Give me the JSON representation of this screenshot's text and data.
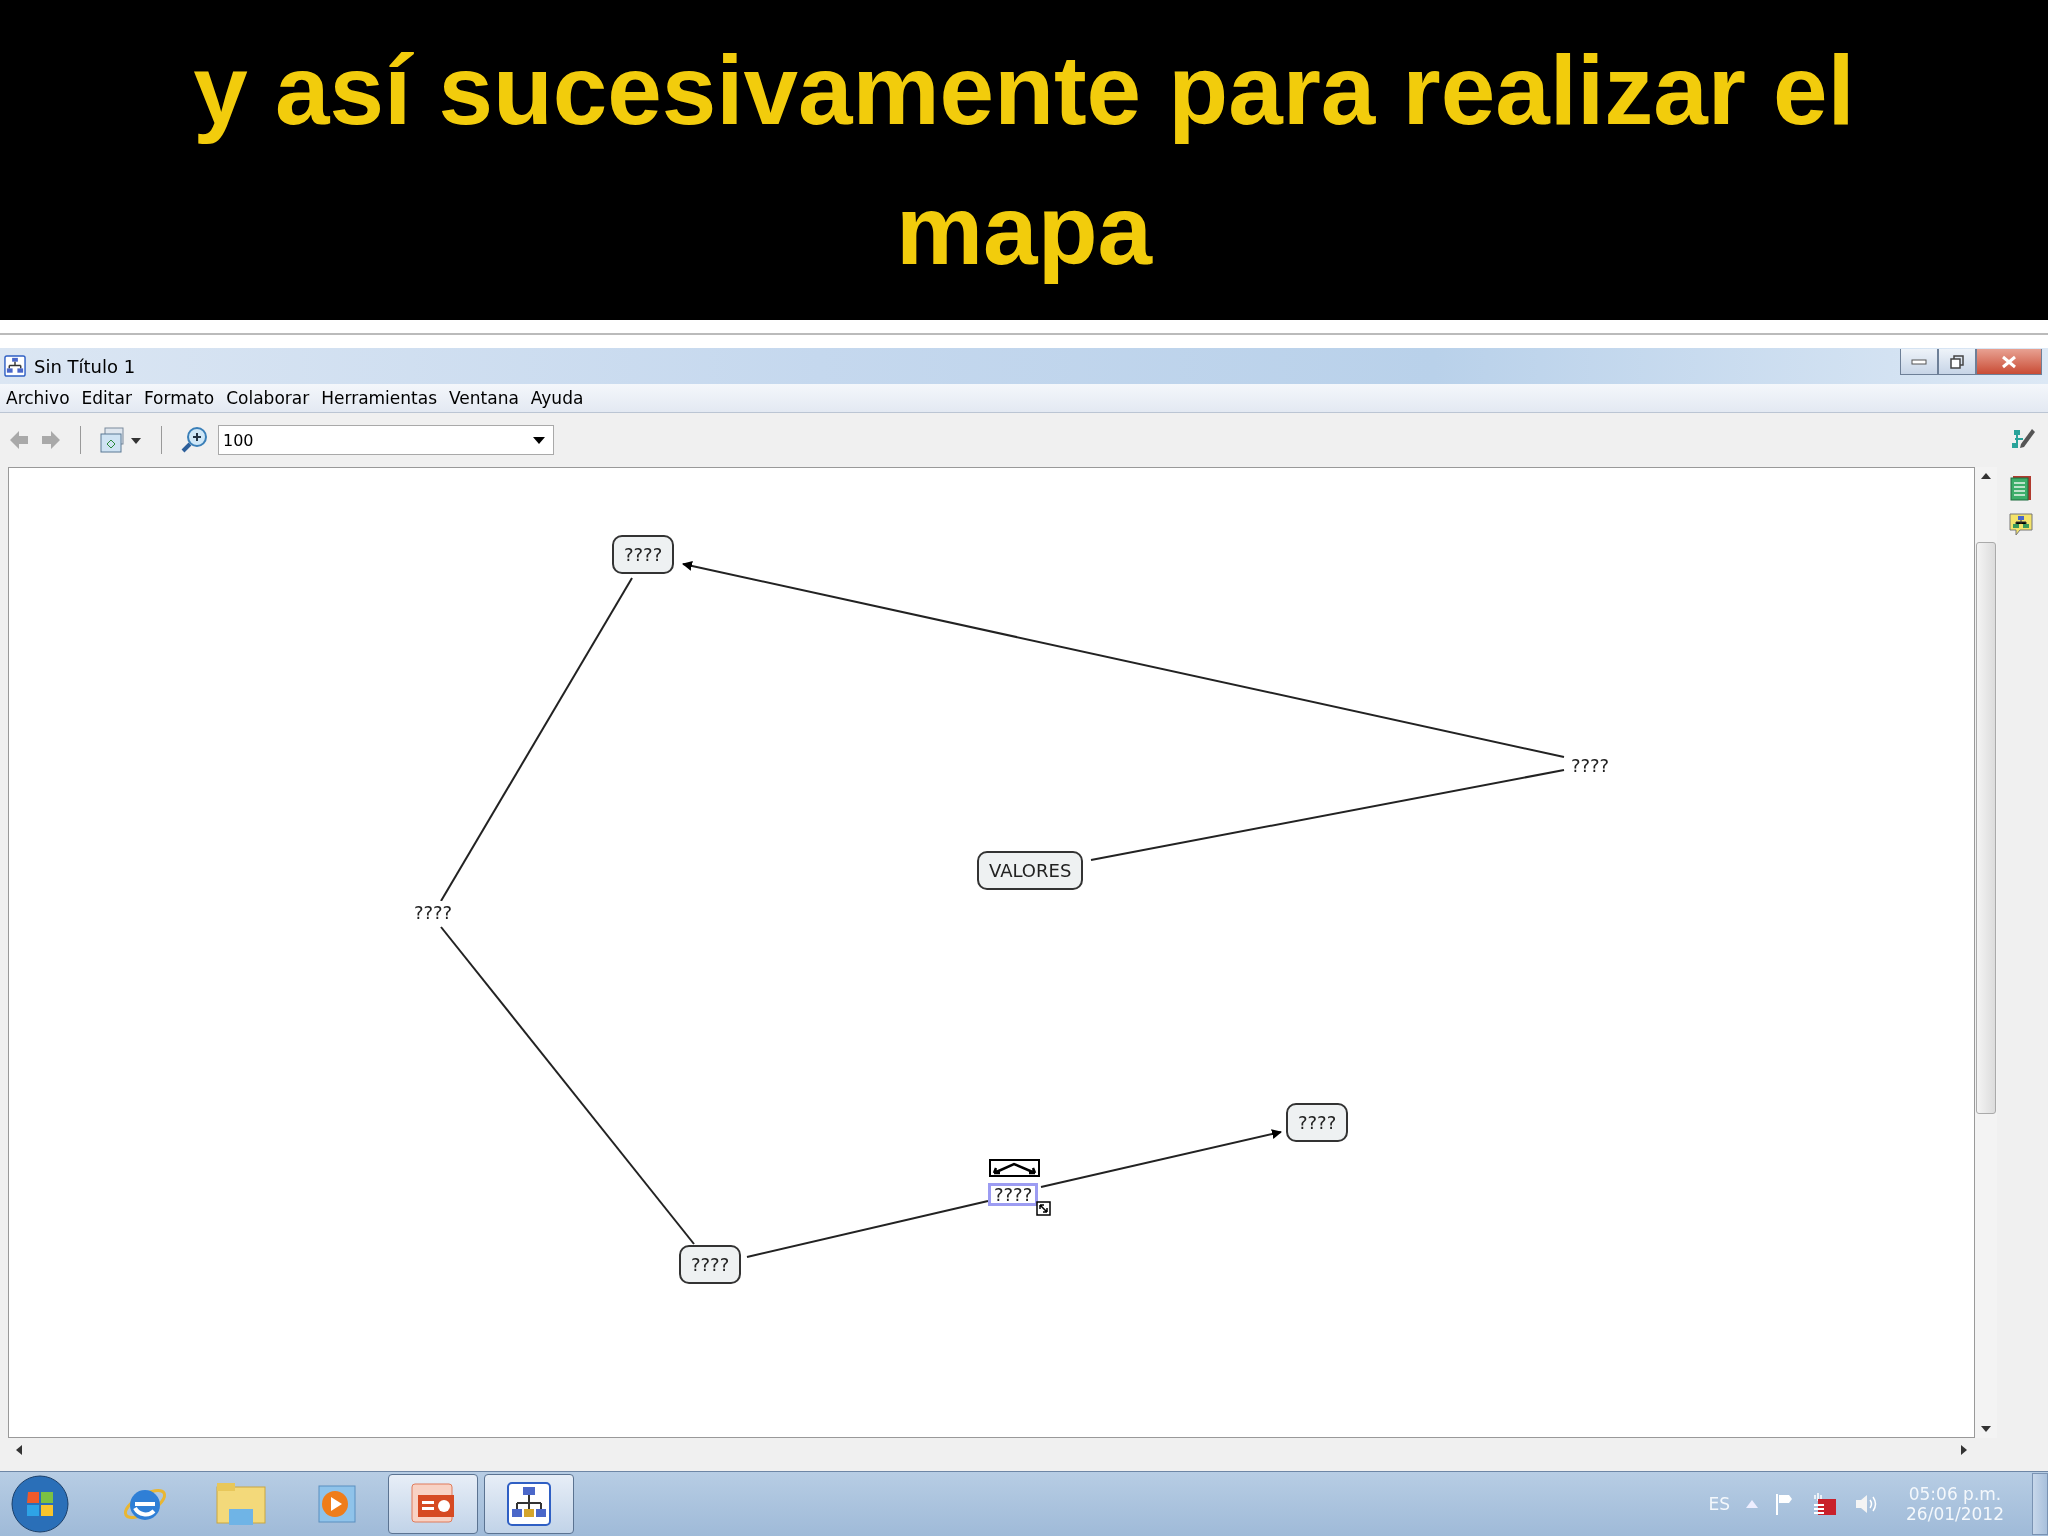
{
  "slide": {
    "title": "y así sucesivamente para realizar el mapa"
  },
  "window": {
    "title": "Sin Título 1"
  },
  "menu": [
    "Archivo",
    "Editar",
    "Formato",
    "Colaborar",
    "Herramientas",
    "Ventana",
    "Ayuda"
  ],
  "toolbar": {
    "zoom": "100"
  },
  "map": {
    "nodes": [
      {
        "kind": "concept",
        "label": "????",
        "selected": false
      },
      {
        "kind": "linking",
        "label": "????",
        "selected": false
      },
      {
        "kind": "concept",
        "label": "VALORES",
        "selected": false
      },
      {
        "kind": "linking",
        "label": "????",
        "selected": false
      },
      {
        "kind": "concept",
        "label": "????",
        "selected": false
      },
      {
        "kind": "linking",
        "label": "????",
        "selected": true
      },
      {
        "kind": "concept",
        "label": "????",
        "selected": false
      }
    ]
  },
  "taskbar": {
    "apps": [
      {
        "kind": "browser",
        "active": false
      },
      {
        "kind": "folder",
        "active": false
      },
      {
        "kind": "media",
        "active": false
      },
      {
        "kind": "slides",
        "active": true
      },
      {
        "kind": "cmap",
        "active": true
      }
    ]
  },
  "tray": {
    "language": "ES",
    "time": "05:06 p.m.",
    "date": "26/01/2012"
  }
}
